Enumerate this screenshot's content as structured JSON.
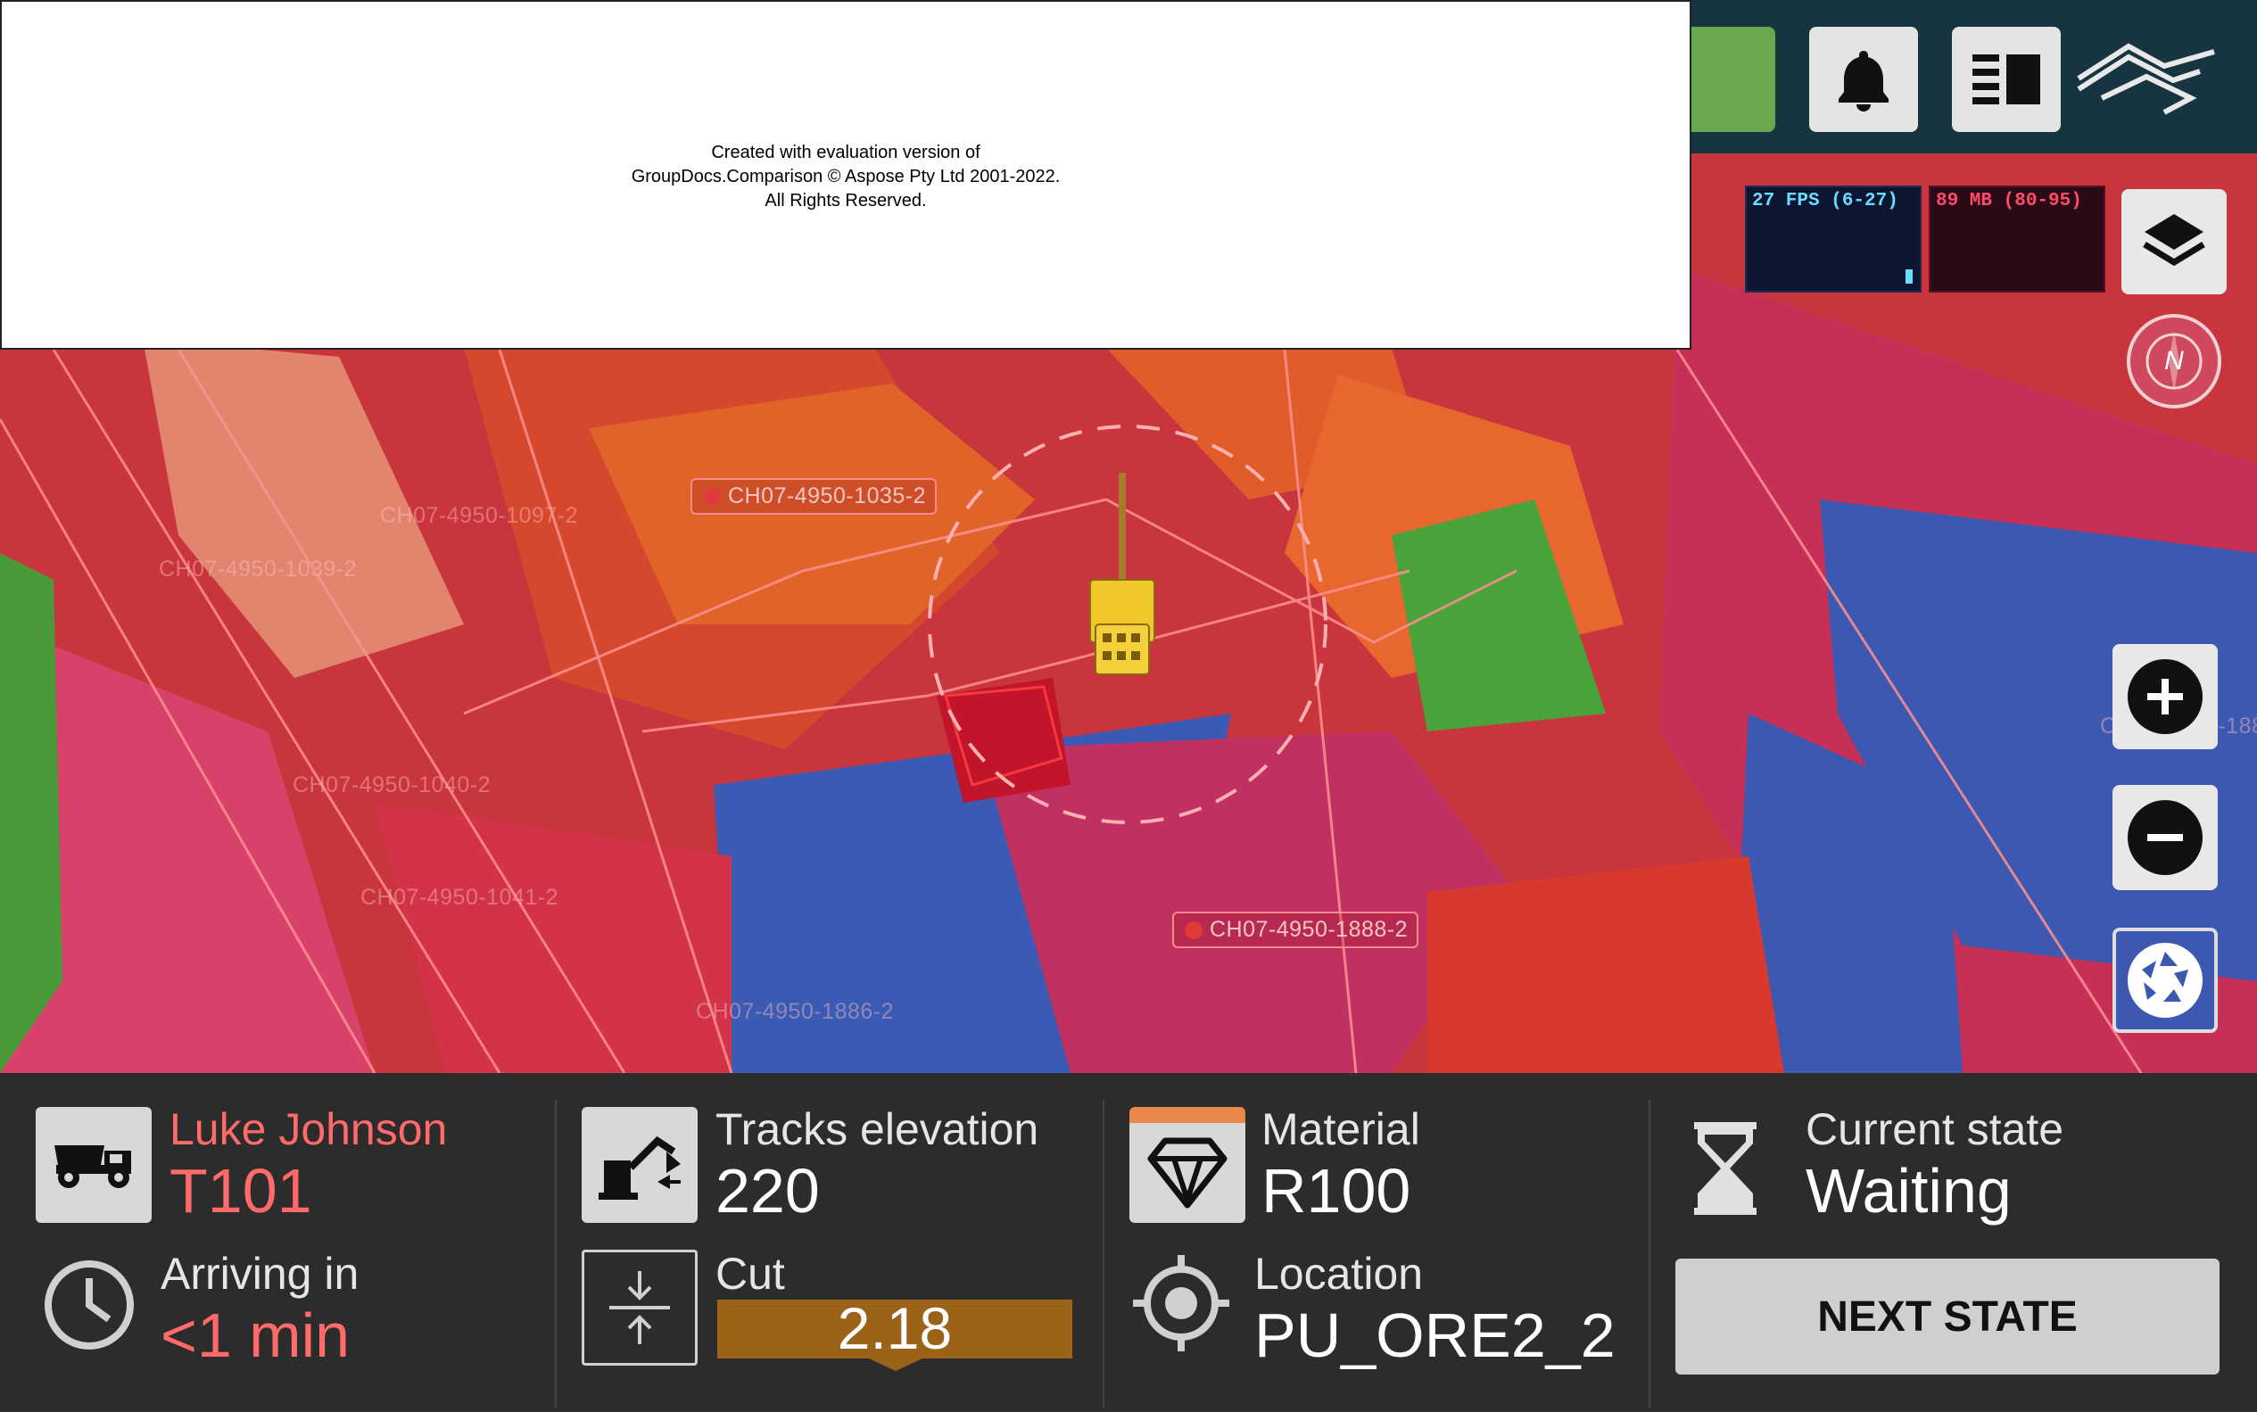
{
  "watermark": {
    "line1": "Created with evaluation version of",
    "line2": "GroupDocs.Comparison © Aspose Pty Ltd 2001-2022.",
    "line3": "All Rights Reserved."
  },
  "perf": {
    "fps": "27 FPS (6-27)",
    "memory": "89 MB (80-95)"
  },
  "map": {
    "labels": [
      "CH07-4950-1035-2",
      "CH07-4950-1097-2",
      "CH07-4950-1039-2",
      "CH07-4950-1040-2",
      "CH07-4950-1041-2",
      "CH07-4950-1888-2",
      "CH07-4950-1886-2",
      "CH07-4950-188"
    ],
    "compass": "N"
  },
  "icons": {
    "notification": "bell-icon",
    "layout": "layout-panel-icon",
    "brand": "brand-logo-icon",
    "layers": "layers-icon",
    "compass": "compass-icon",
    "zoom_in": "plus-icon",
    "zoom_out": "minus-icon",
    "camera": "aperture-icon"
  },
  "panel": {
    "truck": {
      "name": "Luke Johnson",
      "id": "T101"
    },
    "arrival": {
      "label": "Arriving in",
      "value": "<1 min"
    },
    "tracks": {
      "label": "Tracks elevation",
      "value": "220"
    },
    "cut": {
      "label": "Cut",
      "value": "2.18"
    },
    "material": {
      "label": "Material",
      "value": "R100"
    },
    "location": {
      "label": "Location",
      "value": "PU_ORE2_2"
    },
    "state": {
      "label": "Current state",
      "value": "Waiting"
    },
    "next_button": "NEXT STATE"
  },
  "colors": {
    "panel_bg": "#2c2c2c",
    "accent_red": "#ff6a6a",
    "cut_bar": "#9a6318",
    "topbar": "#173541",
    "green": "#6aa84f"
  }
}
